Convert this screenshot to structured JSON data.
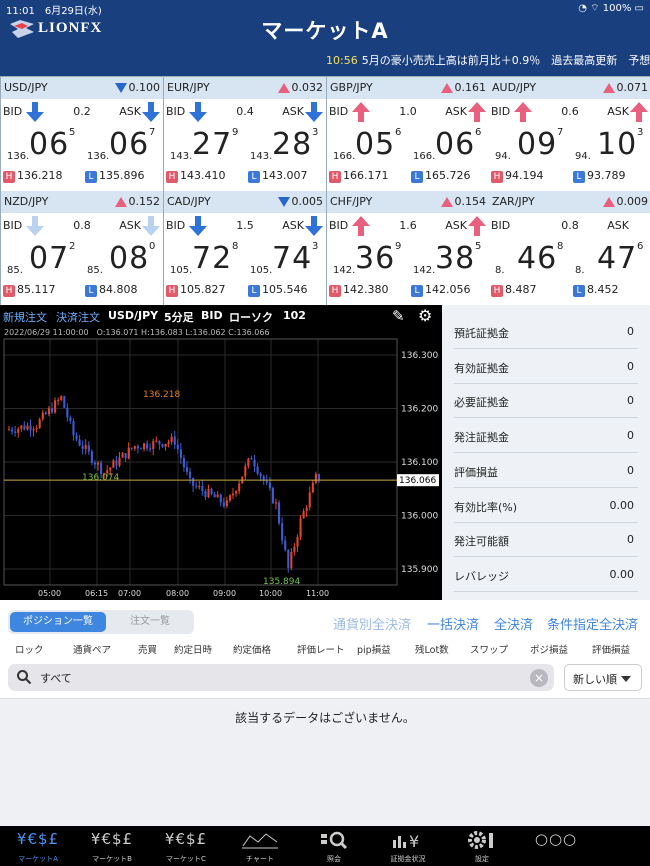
{
  "status": {
    "time": "11:01",
    "date": "6月29日(水)",
    "battery": "100%"
  },
  "brand": "LIONFX",
  "title": "マーケットA",
  "ticker": {
    "time": "10:56",
    "text": "5月の豪小売売上高は前月比＋0.9％　過去最高更新　予想"
  },
  "quotes": [
    {
      "pair": "USD/JPY",
      "dir": "dn",
      "change": "0.100",
      "spread": "0.2",
      "bid_small": "136.",
      "bid_big": "06",
      "bid_sup": "5",
      "ask_small": "136.",
      "ask_big": "06",
      "ask_sup": "7",
      "high": "136.218",
      "low": "135.896",
      "arrow": "down"
    },
    {
      "pair": "EUR/JPY",
      "dir": "up",
      "change": "0.032",
      "spread": "0.4",
      "bid_small": "143.",
      "bid_big": "27",
      "bid_sup": "9",
      "ask_small": "143.",
      "ask_big": "28",
      "ask_sup": "3",
      "high": "143.410",
      "low": "143.007",
      "arrow": "down"
    },
    {
      "pair": "GBP/JPY",
      "dir": "up",
      "change": "0.161",
      "spread": "1.0",
      "bid_small": "166.",
      "bid_big": "05",
      "bid_sup": "6",
      "ask_small": "166.",
      "ask_big": "06",
      "ask_sup": "6",
      "high": "166.171",
      "low": "165.726",
      "arrow": "up"
    },
    {
      "pair": "AUD/JPY",
      "dir": "up",
      "change": "0.071",
      "spread": "0.6",
      "bid_small": "94.",
      "bid_big": "09",
      "bid_sup": "7",
      "ask_small": "94.",
      "ask_big": "10",
      "ask_sup": "3",
      "high": "94.194",
      "low": "93.789",
      "arrow": "up"
    },
    {
      "pair": "NZD/JPY",
      "dir": "up",
      "change": "0.152",
      "spread": "0.8",
      "bid_small": "85.",
      "bid_big": "07",
      "bid_sup": "2",
      "ask_small": "85.",
      "ask_big": "08",
      "ask_sup": "0",
      "high": "85.117",
      "low": "84.808",
      "arrow": "light"
    },
    {
      "pair": "CAD/JPY",
      "dir": "dn",
      "change": "0.005",
      "spread": "1.5",
      "bid_small": "105.",
      "bid_big": "72",
      "bid_sup": "8",
      "ask_small": "105.",
      "ask_big": "74",
      "ask_sup": "3",
      "high": "105.827",
      "low": "105.546",
      "arrow": "down"
    },
    {
      "pair": "CHF/JPY",
      "dir": "up",
      "change": "0.154",
      "spread": "1.6",
      "bid_small": "142.",
      "bid_big": "36",
      "bid_sup": "9",
      "ask_small": "142.",
      "ask_big": "38",
      "ask_sup": "5",
      "high": "142.380",
      "low": "142.056",
      "arrow": "up"
    },
    {
      "pair": "ZAR/JPY",
      "dir": "up",
      "change": "0.009",
      "spread": "0.8",
      "bid_small": "8.",
      "bid_big": "46",
      "bid_sup": "8",
      "ask_small": "8.",
      "ask_big": "47",
      "ask_sup": "6",
      "high": "8.487",
      "low": "8.452",
      "arrow": "none"
    }
  ],
  "chart_toolbar": {
    "new_order": "新規注文",
    "close_order": "決済注文",
    "pair": "USD/JPY",
    "interval": "5分足",
    "side": "BID",
    "style": "ローソク",
    "count": "102"
  },
  "chart_info": "2022/06/29 11:00:00　O:136.071 H:136.083 L:136.062 C:136.066",
  "chart_data": {
    "type": "candlestick",
    "ylim": [
      135.87,
      136.33
    ],
    "y_ticks": [
      "136.300",
      "136.200",
      "136.100",
      "136.000",
      "135.900"
    ],
    "x_ticks": [
      "05:00",
      "06:15",
      "07:00",
      "08:00",
      "09:00",
      "10:00",
      "11:00"
    ],
    "current": "136.066",
    "high_label": "136.218",
    "low_label": "135.894",
    "mid_label": "136.074",
    "colors": {
      "up": "#e0472c",
      "down": "#3d5dd8"
    }
  },
  "summary": [
    {
      "label": "預託証拠金",
      "value": "0"
    },
    {
      "label": "有効証拠金",
      "value": "0"
    },
    {
      "label": "必要証拠金",
      "value": "0"
    },
    {
      "label": "発注証拠金",
      "value": "0"
    },
    {
      "label": "評価損益",
      "value": "0"
    },
    {
      "label": "有効比率(%)",
      "value": "0.00"
    },
    {
      "label": "発注可能額",
      "value": "0"
    },
    {
      "label": "レバレッジ",
      "value": "0.00"
    }
  ],
  "positions": {
    "tab_active": "ポジション一覧",
    "tab_inactive": "注文一覧",
    "actions": [
      "通貨別全決済",
      "一括決済",
      "全決済",
      "条件指定全決済"
    ],
    "columns": [
      "ロック",
      "通貨ペア",
      "売買",
      "約定日時",
      "約定価格",
      "評価レート",
      "pip損益",
      "残Lot数",
      "スワップ",
      "ポジ損益",
      "評価損益"
    ],
    "search_value": "すべて",
    "sort_value": "新しい順",
    "empty_message": "該当するデータはございません。"
  },
  "tabs": [
    {
      "icon": "¥€$£",
      "label": "マーケットA"
    },
    {
      "icon": "¥€$£",
      "label": "マーケットB"
    },
    {
      "icon": "¥€$£",
      "label": "マーケットC"
    },
    {
      "icon": "",
      "label": "チャート"
    },
    {
      "icon": "",
      "label": "照会"
    },
    {
      "icon": "",
      "label": "証拠金状況"
    },
    {
      "icon": "",
      "label": "設定"
    },
    {
      "icon": "○○○",
      "label": ""
    }
  ]
}
